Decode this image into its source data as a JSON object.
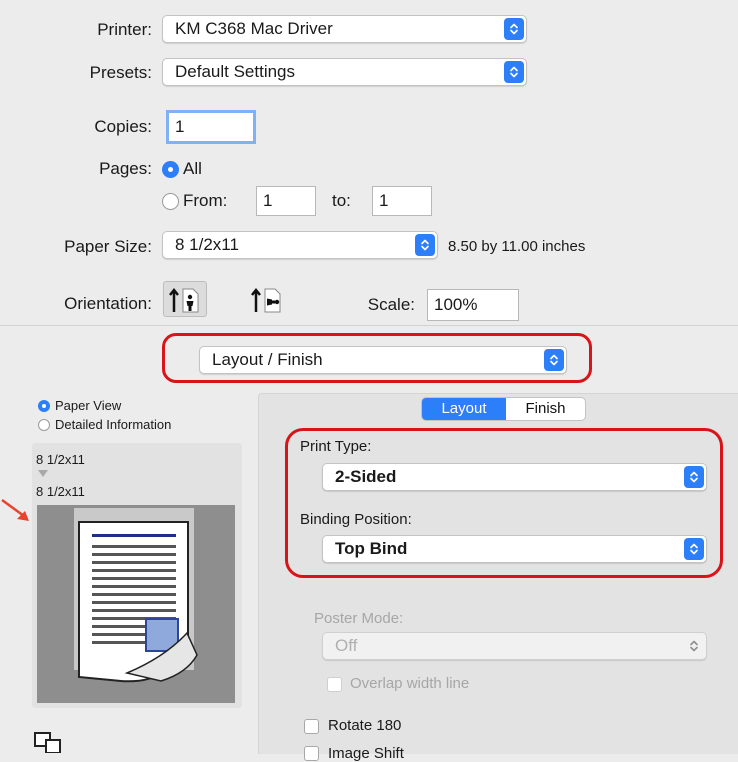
{
  "printer": {
    "label": "Printer:",
    "value": "KM C368 Mac Driver"
  },
  "presets": {
    "label": "Presets:",
    "value": "Default Settings"
  },
  "copies": {
    "label": "Copies:",
    "value": "1"
  },
  "pages": {
    "label": "Pages:",
    "all_label": "All",
    "from_label": "From:",
    "from_value": "1",
    "to_label": "to:",
    "to_value": "1",
    "selected": "All"
  },
  "paper_size": {
    "label": "Paper Size:",
    "value": "8 1/2x11",
    "description": "8.50 by 11.00 inches"
  },
  "orientation": {
    "label": "Orientation:",
    "selected": "portrait"
  },
  "scale": {
    "label": "Scale:",
    "value": "100%"
  },
  "section_popup": {
    "value": "Layout / Finish"
  },
  "preview": {
    "paper_view_label": "Paper View",
    "detailed_info_label": "Detailed Information",
    "selected": "Paper View",
    "source_size": "8 1/2x11",
    "output_size": "8 1/2x11"
  },
  "tabs": [
    {
      "label": "Layout",
      "selected": true
    },
    {
      "label": "Finish",
      "selected": false
    }
  ],
  "print_type": {
    "label": "Print Type:",
    "value": "2-Sided"
  },
  "binding_position": {
    "label": "Binding Position:",
    "value": "Top Bind"
  },
  "poster_mode": {
    "label": "Poster Mode:",
    "value": "Off",
    "enabled": false
  },
  "overlap_width": {
    "label": "Overlap width line",
    "enabled": false
  },
  "rotate_180": {
    "label": "Rotate 180"
  },
  "image_shift": {
    "label": "Image Shift"
  },
  "colors": {
    "accent": "#2d7ff9",
    "highlight_box": "#d91418",
    "annotation_arrow": "#e8432c",
    "background": "#ececec"
  }
}
